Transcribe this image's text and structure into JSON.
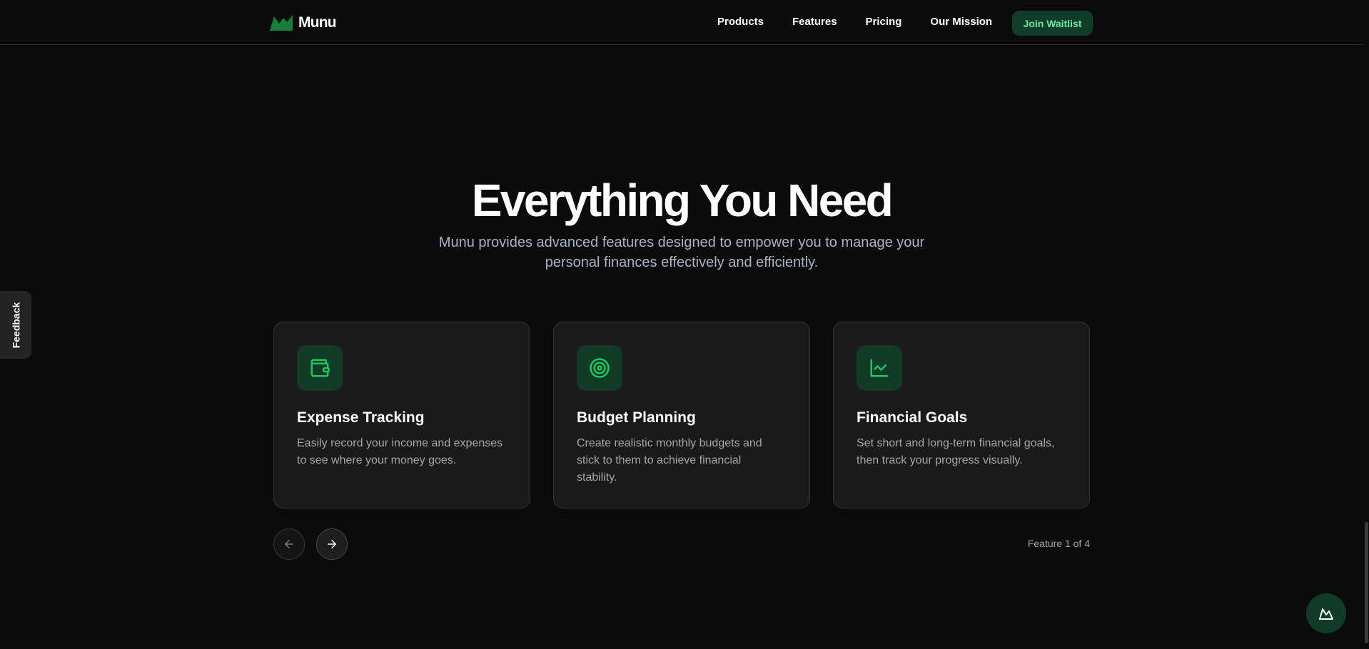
{
  "header": {
    "logo_text": "Munu",
    "nav": [
      "Products",
      "Features",
      "Pricing",
      "Our Mission"
    ],
    "cta": "Join Waitlist"
  },
  "hero": {
    "title": "Everything You Need",
    "subtitle": "Munu provides advanced features designed to empower you to manage your personal finances effectively and efficiently."
  },
  "feedback_label": "Feedback",
  "features": [
    {
      "icon": "wallet-icon",
      "title": "Expense Tracking",
      "description": "Easily record your income and expenses to see where your money goes."
    },
    {
      "icon": "target-icon",
      "title": "Budget Planning",
      "description": "Create realistic monthly budgets and stick to them to achieve financial stability."
    },
    {
      "icon": "line-chart-icon",
      "title": "Financial Goals",
      "description": "Set short and long-term financial goals, then track your progress visually."
    }
  ],
  "carousel": {
    "counter": "Feature 1 of 4"
  },
  "colors": {
    "background": "#0b0b0b",
    "card": "#1a1a1a",
    "accent": "#22c55e",
    "accent_bg": "#0f3b27",
    "muted_text": "#a6a6a6"
  }
}
